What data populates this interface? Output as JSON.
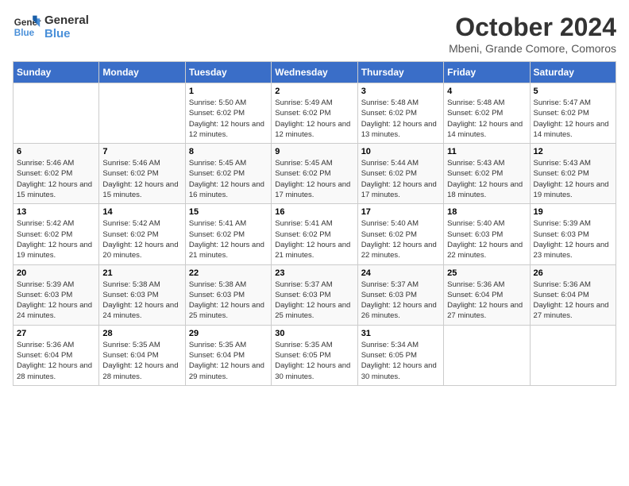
{
  "logo": {
    "line1": "General",
    "line2": "Blue"
  },
  "header": {
    "month": "October 2024",
    "location": "Mbeni, Grande Comore, Comoros"
  },
  "weekdays": [
    "Sunday",
    "Monday",
    "Tuesday",
    "Wednesday",
    "Thursday",
    "Friday",
    "Saturday"
  ],
  "weeks": [
    [
      {
        "day": "",
        "info": ""
      },
      {
        "day": "",
        "info": ""
      },
      {
        "day": "1",
        "info": "Sunrise: 5:50 AM\nSunset: 6:02 PM\nDaylight: 12 hours and 12 minutes."
      },
      {
        "day": "2",
        "info": "Sunrise: 5:49 AM\nSunset: 6:02 PM\nDaylight: 12 hours and 12 minutes."
      },
      {
        "day": "3",
        "info": "Sunrise: 5:48 AM\nSunset: 6:02 PM\nDaylight: 12 hours and 13 minutes."
      },
      {
        "day": "4",
        "info": "Sunrise: 5:48 AM\nSunset: 6:02 PM\nDaylight: 12 hours and 14 minutes."
      },
      {
        "day": "5",
        "info": "Sunrise: 5:47 AM\nSunset: 6:02 PM\nDaylight: 12 hours and 14 minutes."
      }
    ],
    [
      {
        "day": "6",
        "info": "Sunrise: 5:46 AM\nSunset: 6:02 PM\nDaylight: 12 hours and 15 minutes."
      },
      {
        "day": "7",
        "info": "Sunrise: 5:46 AM\nSunset: 6:02 PM\nDaylight: 12 hours and 15 minutes."
      },
      {
        "day": "8",
        "info": "Sunrise: 5:45 AM\nSunset: 6:02 PM\nDaylight: 12 hours and 16 minutes."
      },
      {
        "day": "9",
        "info": "Sunrise: 5:45 AM\nSunset: 6:02 PM\nDaylight: 12 hours and 17 minutes."
      },
      {
        "day": "10",
        "info": "Sunrise: 5:44 AM\nSunset: 6:02 PM\nDaylight: 12 hours and 17 minutes."
      },
      {
        "day": "11",
        "info": "Sunrise: 5:43 AM\nSunset: 6:02 PM\nDaylight: 12 hours and 18 minutes."
      },
      {
        "day": "12",
        "info": "Sunrise: 5:43 AM\nSunset: 6:02 PM\nDaylight: 12 hours and 19 minutes."
      }
    ],
    [
      {
        "day": "13",
        "info": "Sunrise: 5:42 AM\nSunset: 6:02 PM\nDaylight: 12 hours and 19 minutes."
      },
      {
        "day": "14",
        "info": "Sunrise: 5:42 AM\nSunset: 6:02 PM\nDaylight: 12 hours and 20 minutes."
      },
      {
        "day": "15",
        "info": "Sunrise: 5:41 AM\nSunset: 6:02 PM\nDaylight: 12 hours and 21 minutes."
      },
      {
        "day": "16",
        "info": "Sunrise: 5:41 AM\nSunset: 6:02 PM\nDaylight: 12 hours and 21 minutes."
      },
      {
        "day": "17",
        "info": "Sunrise: 5:40 AM\nSunset: 6:02 PM\nDaylight: 12 hours and 22 minutes."
      },
      {
        "day": "18",
        "info": "Sunrise: 5:40 AM\nSunset: 6:03 PM\nDaylight: 12 hours and 22 minutes."
      },
      {
        "day": "19",
        "info": "Sunrise: 5:39 AM\nSunset: 6:03 PM\nDaylight: 12 hours and 23 minutes."
      }
    ],
    [
      {
        "day": "20",
        "info": "Sunrise: 5:39 AM\nSunset: 6:03 PM\nDaylight: 12 hours and 24 minutes."
      },
      {
        "day": "21",
        "info": "Sunrise: 5:38 AM\nSunset: 6:03 PM\nDaylight: 12 hours and 24 minutes."
      },
      {
        "day": "22",
        "info": "Sunrise: 5:38 AM\nSunset: 6:03 PM\nDaylight: 12 hours and 25 minutes."
      },
      {
        "day": "23",
        "info": "Sunrise: 5:37 AM\nSunset: 6:03 PM\nDaylight: 12 hours and 25 minutes."
      },
      {
        "day": "24",
        "info": "Sunrise: 5:37 AM\nSunset: 6:03 PM\nDaylight: 12 hours and 26 minutes."
      },
      {
        "day": "25",
        "info": "Sunrise: 5:36 AM\nSunset: 6:04 PM\nDaylight: 12 hours and 27 minutes."
      },
      {
        "day": "26",
        "info": "Sunrise: 5:36 AM\nSunset: 6:04 PM\nDaylight: 12 hours and 27 minutes."
      }
    ],
    [
      {
        "day": "27",
        "info": "Sunrise: 5:36 AM\nSunset: 6:04 PM\nDaylight: 12 hours and 28 minutes."
      },
      {
        "day": "28",
        "info": "Sunrise: 5:35 AM\nSunset: 6:04 PM\nDaylight: 12 hours and 28 minutes."
      },
      {
        "day": "29",
        "info": "Sunrise: 5:35 AM\nSunset: 6:04 PM\nDaylight: 12 hours and 29 minutes."
      },
      {
        "day": "30",
        "info": "Sunrise: 5:35 AM\nSunset: 6:05 PM\nDaylight: 12 hours and 30 minutes."
      },
      {
        "day": "31",
        "info": "Sunrise: 5:34 AM\nSunset: 6:05 PM\nDaylight: 12 hours and 30 minutes."
      },
      {
        "day": "",
        "info": ""
      },
      {
        "day": "",
        "info": ""
      }
    ]
  ]
}
